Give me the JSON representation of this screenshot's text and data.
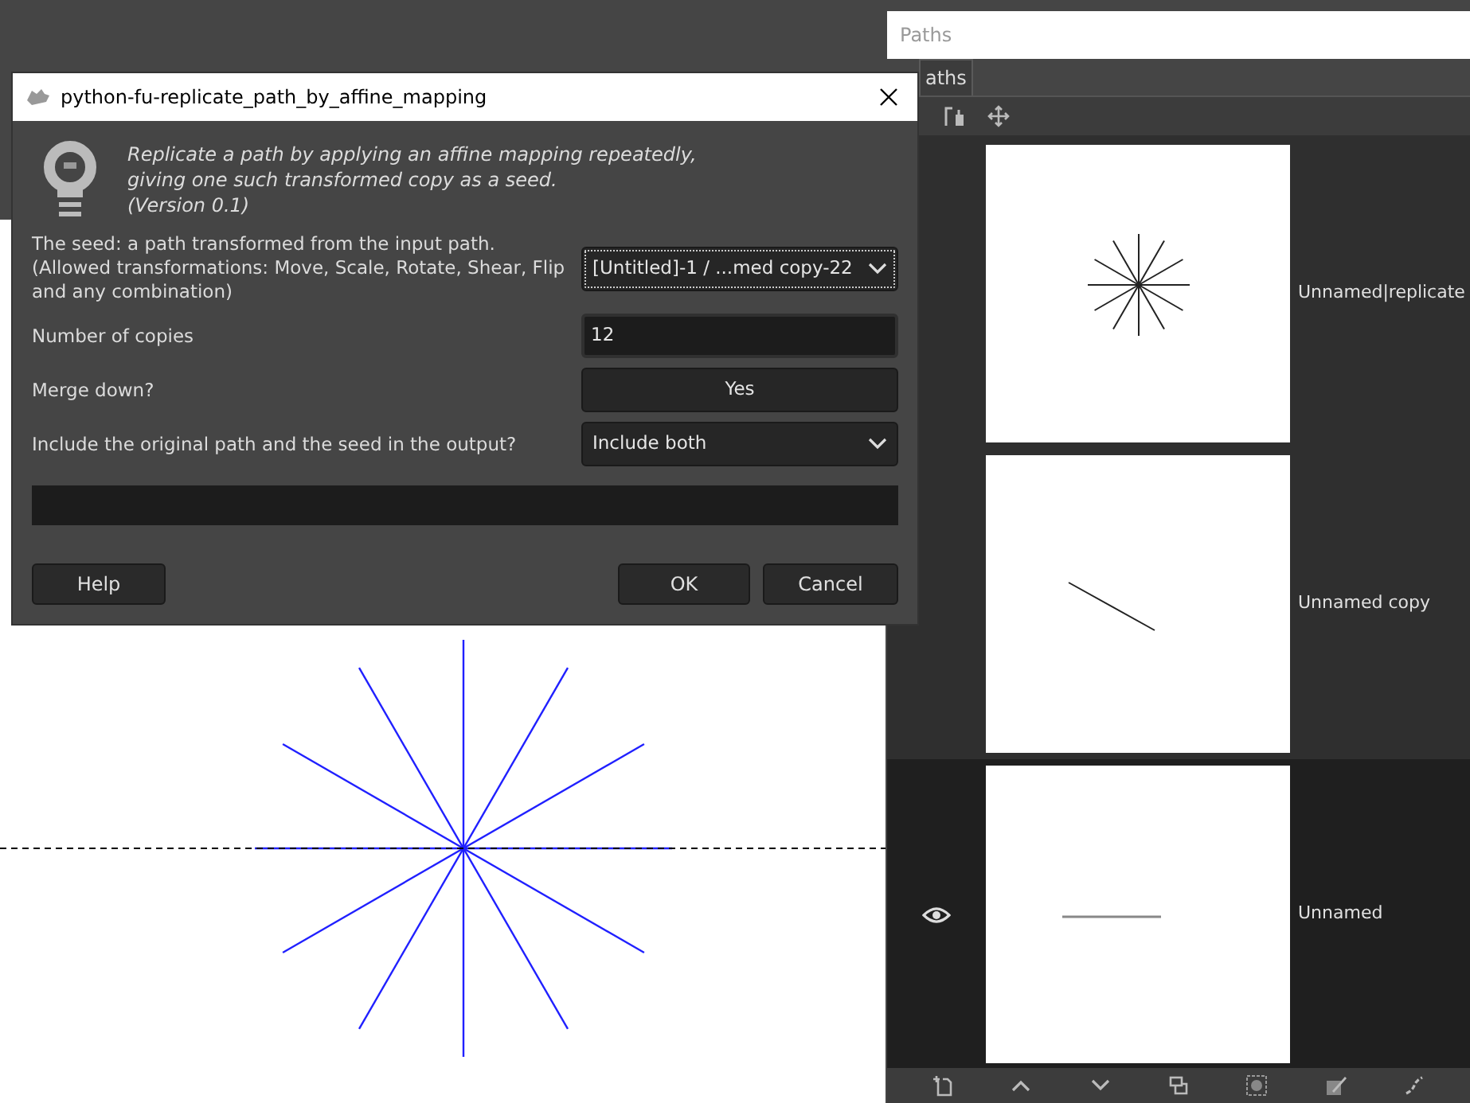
{
  "dialog": {
    "title": "python-fu-replicate_path_by_affine_mapping",
    "description": [
      "Replicate a path by applying an affine mapping repeatedly,",
      "giving one such transformed copy as a seed.",
      "(Version 0.1)"
    ],
    "fields": [
      {
        "kind": "select",
        "label": [
          "The seed: a path transformed from the input path.",
          "(Allowed transformations: Move, Scale, Rotate, Shear, Flip",
          "and any combination)"
        ],
        "value": "[Untitled]-1 / ...med copy-22",
        "focused": true
      },
      {
        "kind": "input",
        "label": [
          "Number of copies"
        ],
        "value": "12",
        "focused": false
      },
      {
        "kind": "toggle",
        "label": [
          "Merge down?"
        ],
        "value": "Yes",
        "focused": false
      },
      {
        "kind": "select",
        "label": [
          "Include the original path and the seed in the output?"
        ],
        "value": "Include both",
        "focused": false
      }
    ],
    "progress": {
      "level": 0
    },
    "buttons": {
      "help": "Help",
      "ok": "OK",
      "cancel": "Cancel"
    }
  },
  "paths_panel": {
    "title": "Paths",
    "tab": "aths",
    "paths": [
      {
        "name": "Unnamed|replicate",
        "kind": "star",
        "visible": false,
        "selected": false
      },
      {
        "name": "Unnamed copy",
        "kind": "diagonal",
        "visible": false,
        "selected": false
      },
      {
        "name": "Unnamed",
        "kind": "horizontal",
        "visible": true,
        "selected": true
      }
    ]
  }
}
